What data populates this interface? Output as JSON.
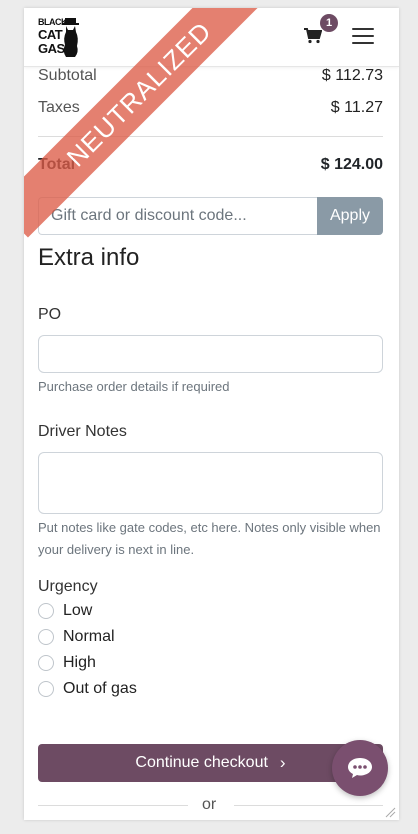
{
  "header": {
    "logo_lines": [
      "BLACK",
      "CAT",
      "GAS"
    ],
    "cart_count": "1",
    "icons": {
      "cart": "cart-icon",
      "menu": "hamburger-menu-icon"
    }
  },
  "ribbon": {
    "text": "NEUTRALIZED",
    "color": "#dc5c48"
  },
  "summary": {
    "subtotal_label": "Subtotal",
    "subtotal_value": "$ 112.73",
    "taxes_label": "Taxes",
    "taxes_value": "$ 11.27",
    "total_label": "Total",
    "total_value": "$ 124.00"
  },
  "discount": {
    "placeholder": "Gift card or discount code...",
    "value": "",
    "apply_label": "Apply"
  },
  "extra_info": {
    "title": "Extra info",
    "po": {
      "label": "PO",
      "value": "",
      "help": "Purchase order details if required"
    },
    "driver_notes": {
      "label": "Driver Notes",
      "value": "",
      "help": "Put notes like gate codes, etc here. Notes only visible when your delivery is next in line."
    },
    "urgency": {
      "label": "Urgency",
      "options": [
        "Low",
        "Normal",
        "High",
        "Out of gas"
      ],
      "selected": null
    }
  },
  "actions": {
    "continue_label": "Continue checkout",
    "or_label": "or"
  },
  "colors": {
    "primary": "#6d4b63",
    "apply_button": "#8a9aa6",
    "chat_button": "#7a4f6f"
  },
  "chat": {
    "icon": "chat-bubble-icon"
  }
}
